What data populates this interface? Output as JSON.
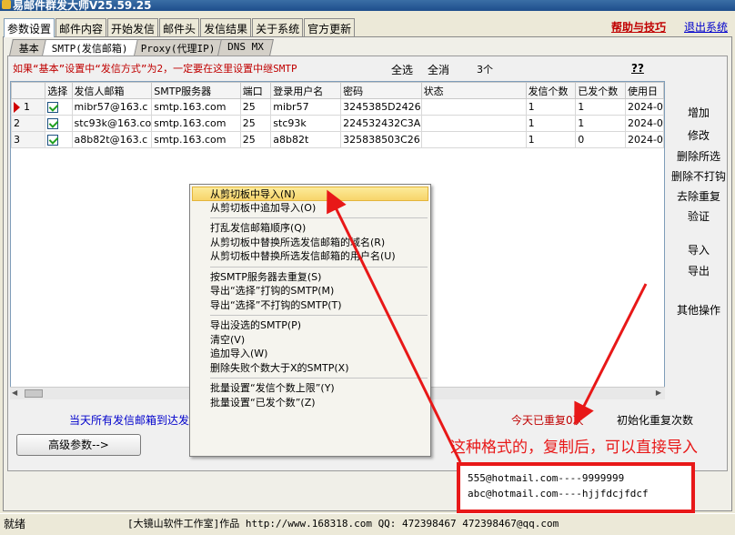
{
  "window": {
    "title": "易邮件群发大师V25.59.25"
  },
  "main_tabs": [
    "参数设置",
    "邮件内容",
    "开始发信",
    "邮件头",
    "发信结果",
    "关于系统",
    "官方更新"
  ],
  "help_link": "帮助与技巧",
  "exit_link": "退出系统",
  "sub_tabs": [
    "基本",
    "SMTP(发信邮箱)",
    "Proxy(代理IP)",
    "DNS MX"
  ],
  "warning_text": "如果“基本”设置中“发信方式”为2，一定要在这里设置中继SMTP",
  "select_all": "全选",
  "clear_all": "全消",
  "count_label": "3个",
  "help_qq": "??",
  "table": {
    "columns": [
      "选择",
      "发信人邮箱",
      "SMTP服务器",
      "端口",
      "登录用户名",
      "密码",
      "状态",
      "发信个数",
      "已发个数",
      "使用日"
    ],
    "rows": [
      {
        "num": "1",
        "email": "mibr57@163.c",
        "smtp": "smtp.163.com",
        "port": "25",
        "user": "mibr57",
        "password": "3245385D2426",
        "status": "",
        "send_count": "1",
        "sent": "1",
        "date": "2024-0"
      },
      {
        "num": "2",
        "email": "stc93k@163.co",
        "smtp": "smtp.163.com",
        "port": "25",
        "user": "stc93k",
        "password": "224532432C3A",
        "status": "",
        "send_count": "1",
        "sent": "1",
        "date": "2024-0"
      },
      {
        "num": "3",
        "email": "a8b82t@163.c",
        "smtp": "smtp.163.com",
        "port": "25",
        "user": "a8b82t",
        "password": "325838503C26",
        "status": "",
        "send_count": "1",
        "sent": "0",
        "date": "2024-0"
      }
    ]
  },
  "right_buttons": {
    "add": "增加",
    "edit": "修改",
    "delete_selected": "删除所选",
    "delete_unchecked": "删除不打钩",
    "dedupe": "去除重复",
    "verify": "验证",
    "import": "导入",
    "export": "导出",
    "other": "其他操作"
  },
  "bottom_info": "当天所有发信邮箱到达发",
  "advanced_button": "高级参数-->",
  "today_repeat": "今天已重复0次",
  "init_repeat": "初始化重复次数",
  "context_menu": [
    "从剪切板中导入(N)",
    "从剪切板中追加导入(O)",
    "打乱发信邮箱顺序(Q)",
    "从剪切板中替换所选发信邮箱的域名(R)",
    "从剪切板中替换所选发信邮箱的用户名(U)",
    "按SMTP服务器去重复(S)",
    "导出“选择”打钩的SMTP(M)",
    "导出“选择”不打钩的SMTP(T)",
    "导出没选的SMTP(P)",
    "清空(V)",
    "追加导入(W)",
    "删除失败个数大于X的SMTP(X)",
    "批量设置“发信个数上限”(Y)",
    "批量设置“已发个数”(Z)"
  ],
  "annotation": "这种格式的，复制后，可以直接导入",
  "sample_lines": [
    "555@hotmail.com----9999999",
    "abc@hotmail.com----hjjfdcjfdcf"
  ],
  "status_bar": {
    "left": "就绪",
    "center": "[大镜山软件工作室]作品 http://www.168318.com QQ: 472398467 472398467@qq.com"
  },
  "colors": {
    "warning_red": "#C00000",
    "annotation_red": "#E81818",
    "link_blue": "#0000CC",
    "menu_highlight": "#F7D46A"
  }
}
